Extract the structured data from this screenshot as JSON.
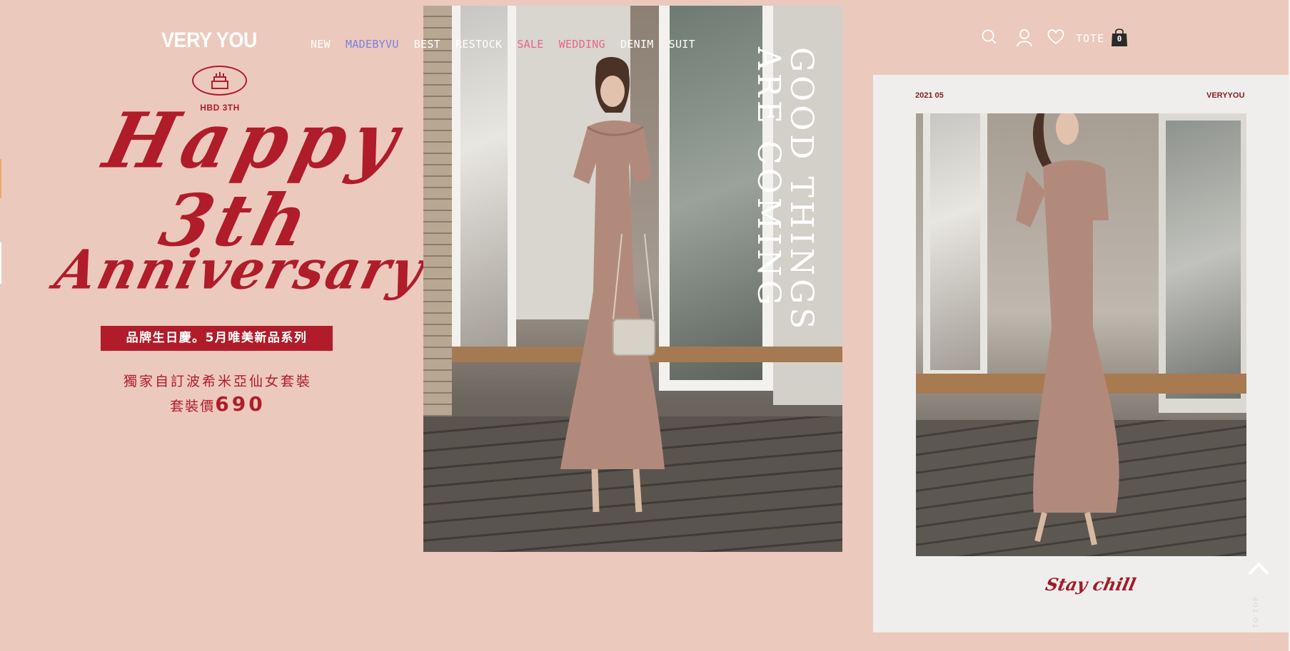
{
  "header": {
    "logo": "VERY YOU",
    "nav": [
      {
        "label": "NEW",
        "color": "#ffffff"
      },
      {
        "label": "MADEBYVU",
        "color": "#7a7fe0"
      },
      {
        "label": "BEST",
        "color": "#ffffff"
      },
      {
        "label": "RESTOCK",
        "color": "#ffffff"
      },
      {
        "label": "SALE",
        "color": "#e2688a"
      },
      {
        "label": "WEDDING",
        "color": "#e2688a"
      },
      {
        "label": "DENIM",
        "color": "#ffffff"
      },
      {
        "label": "SUIT",
        "color": "#ffffff"
      }
    ],
    "icons": [
      "search-icon",
      "user-icon",
      "heart-icon",
      "shopping-bag-icon"
    ],
    "tote_label": "TOTE",
    "cart_count": "0"
  },
  "promo": {
    "badge_text": "HBD 3TH",
    "script_line1": "Happy",
    "script_line2": "3th",
    "script_line3": "Anniversary",
    "banner": "品牌生日慶。5月唯美新品系列",
    "subtitle": "獨家自訂波希米亞仙女套裝",
    "price_label": "套裝價",
    "price_value": "690",
    "accent_color": "#b01c2a"
  },
  "hero": {
    "vertical_line1": "GOOD THINGS",
    "vertical_line2": "ARE COMING"
  },
  "card": {
    "date": "2021 05",
    "brand": "VERYYOU",
    "caption": "Stay chill"
  },
  "back_to_top": "BACK TO TOP",
  "colors": {
    "background": "#ecc9bd",
    "card_background": "#efeeec"
  }
}
